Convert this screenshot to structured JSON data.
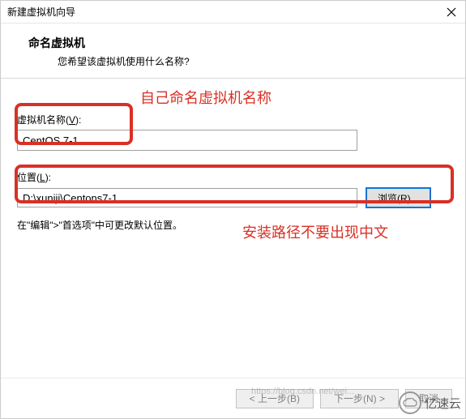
{
  "window": {
    "title": "新建虚拟机向导"
  },
  "header": {
    "title": "命名虚拟机",
    "subtitle": "您希望该虚拟机使用什么名称?"
  },
  "annotations": {
    "name_hint": "自己命名虚拟机名称",
    "path_hint": "安装路径不要出现中文"
  },
  "fields": {
    "name_label_prefix": "虚拟机名称(",
    "name_label_key": "V",
    "name_label_suffix": "):",
    "name_value": "CentOS 7-1",
    "location_label_prefix": "位置(",
    "location_label_key": "L",
    "location_label_suffix": "):",
    "location_value": "D:\\xuniji\\Centons7-1",
    "browse_label": "浏览(R)...",
    "hint": "在\"编辑\">\"首选项\"中可更改默认位置。"
  },
  "footer": {
    "back": "< 上一步(B)",
    "next": "下一步(N) >",
    "cancel": "取消"
  },
  "watermark": {
    "text": "亿速云",
    "url": "https://blog.csdn.net/wei..."
  }
}
